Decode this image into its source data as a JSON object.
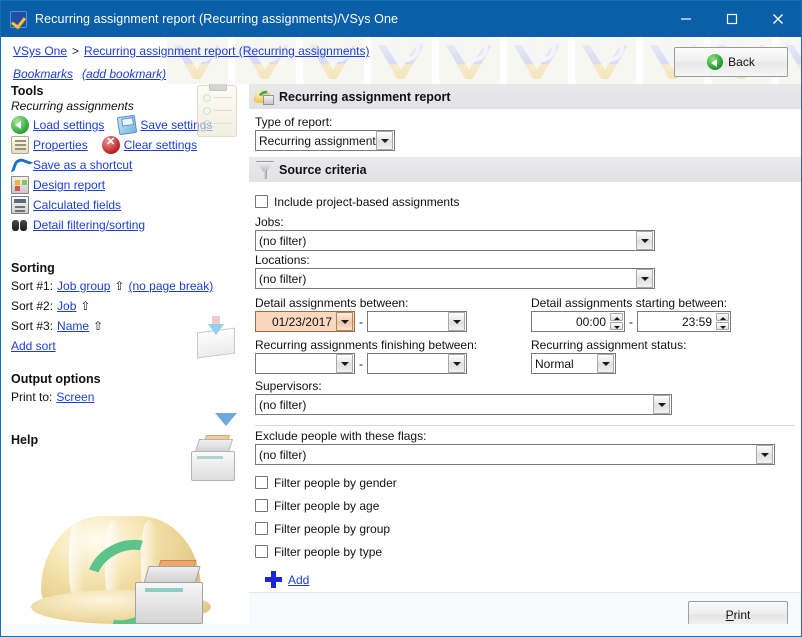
{
  "window": {
    "title": "Recurring assignment report (Recurring assignments)/VSys One",
    "icon": "vsys-checkmark-icon",
    "minimize": "—",
    "maximize": "☐",
    "close": "✕"
  },
  "breadcrumb": {
    "root": "VSys One",
    "separator": ">",
    "current": "Recurring assignment report (Recurring assignments)"
  },
  "bookmarks": {
    "label": "Bookmarks",
    "add": "(add bookmark)"
  },
  "back_button": {
    "label": "Back"
  },
  "sidebar": {
    "tools": {
      "heading": "Tools",
      "subheading": "Recurring assignments",
      "items": [
        {
          "label": "Load settings",
          "icon": "load-settings-icon"
        },
        {
          "label": "Save settings",
          "icon": "save-settings-icon"
        },
        {
          "label": "Properties",
          "icon": "properties-icon"
        },
        {
          "label": "Clear settings",
          "icon": "clear-settings-icon"
        },
        {
          "label": "Save as a shortcut",
          "icon": "shortcut-icon"
        },
        {
          "label": "Design report",
          "icon": "design-report-icon"
        },
        {
          "label": "Calculated fields",
          "icon": "calculated-fields-icon"
        },
        {
          "label": "Detail filtering/sorting",
          "icon": "binoculars-icon"
        }
      ]
    },
    "sorting": {
      "heading": "Sorting",
      "rows": [
        {
          "prefix": "Sort #1:",
          "field": "Job group",
          "direction": "⇧",
          "extra": "(no page break)"
        },
        {
          "prefix": "Sort #2:",
          "field": "Job",
          "direction": "⇧",
          "extra": ""
        },
        {
          "prefix": "Sort #3:",
          "field": "Name",
          "direction": "⇧",
          "extra": ""
        }
      ],
      "add_sort": "Add sort"
    },
    "output": {
      "heading": "Output options",
      "print_to_label": "Print to:",
      "print_to_value": "Screen"
    },
    "help": {
      "heading": "Help"
    }
  },
  "main": {
    "report_header": {
      "title": "Recurring assignment report",
      "icon": "recurring-report-icon"
    },
    "type_of_report": {
      "label": "Type of report:",
      "value": "Recurring assignments"
    },
    "source_criteria": {
      "title": "Source criteria",
      "icon": "funnel-icon"
    },
    "include_project_based": {
      "label": "Include project-based assignments",
      "checked": false
    },
    "jobs": {
      "label": "Jobs:",
      "value": "(no filter)"
    },
    "locations": {
      "label": "Locations:",
      "value": "(no filter)"
    },
    "detail_between": {
      "label": "Detail assignments between:",
      "from": "01/23/2017",
      "dash": "-",
      "to": ""
    },
    "detail_starting_between": {
      "label": "Detail assignments starting between:",
      "from": "00:00",
      "dash": "-",
      "to": "23:59"
    },
    "recurring_finishing_between": {
      "label": "Recurring assignments finishing between:",
      "from": "",
      "dash": "-",
      "to": ""
    },
    "recurring_status": {
      "label": "Recurring assignment status:",
      "value": "Normal"
    },
    "supervisors": {
      "label": "Supervisors:",
      "value": "(no filter)"
    },
    "exclude_flags": {
      "label": "Exclude people with these flags:",
      "value": "(no filter)"
    },
    "people_filters": [
      {
        "label": "Filter people by gender",
        "checked": false
      },
      {
        "label": "Filter people by age",
        "checked": false
      },
      {
        "label": "Filter people by group",
        "checked": false
      },
      {
        "label": "Filter people by type",
        "checked": false
      }
    ],
    "add_link": {
      "label": "Add",
      "icon": "plus-icon"
    }
  },
  "footer": {
    "print_button": {
      "accel": "P",
      "rest": "rint"
    }
  },
  "colors": {
    "titlebar": "#0a5fa8",
    "link": "#1b3fd4",
    "highlight_field": "#fad8c0",
    "section_header": "#e5e5e9"
  }
}
